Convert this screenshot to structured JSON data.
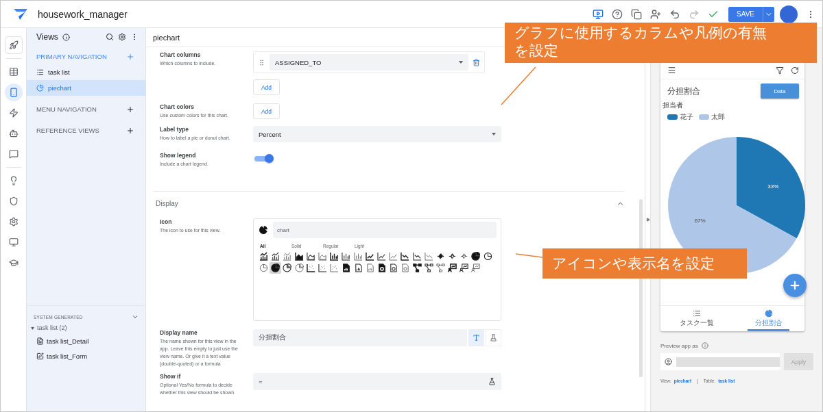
{
  "app": {
    "title": "housework_manager",
    "save_label": "SAVE"
  },
  "rail": {
    "groups": [
      {
        "items": [
          {
            "kind": "rocket",
            "selected": false
          }
        ]
      },
      {
        "items": [
          {
            "kind": "table",
            "selected": false
          },
          {
            "kind": "phone",
            "selected": true
          },
          {
            "kind": "bolt",
            "selected": false
          },
          {
            "kind": "robot",
            "selected": false
          },
          {
            "kind": "chat",
            "selected": false
          }
        ]
      },
      {
        "items": [
          {
            "kind": "bulb",
            "selected": false
          },
          {
            "kind": "shield",
            "selected": false
          },
          {
            "kind": "gear",
            "selected": false
          },
          {
            "kind": "monitor",
            "selected": false
          },
          {
            "kind": "cap",
            "selected": false
          }
        ]
      }
    ]
  },
  "sidebar": {
    "title": "Views",
    "sections": [
      {
        "label": "PRIMARY NAVIGATION",
        "items": [
          {
            "label": "task list",
            "kind": "list",
            "selected": false
          },
          {
            "label": "piechart",
            "kind": "pie",
            "selected": true
          }
        ]
      },
      {
        "label": "MENU NAVIGATION"
      },
      {
        "label": "REFERENCE VIEWS"
      }
    ],
    "system": {
      "label": "SYSTEM GENERATED",
      "expanded": true,
      "tree": [
        {
          "label": "task list (2)",
          "expanded": true,
          "children": [
            {
              "label": "task list_Detail",
              "kind": "detail"
            },
            {
              "label": "task list_Form",
              "kind": "form"
            }
          ]
        }
      ]
    }
  },
  "editor": {
    "title": "piechart",
    "fields": [
      {
        "kind": "columns",
        "label": "Chart columns",
        "hint": "Which columns to include.",
        "value": "ASSIGNED_TO",
        "add_label": "Add"
      },
      {
        "kind": "add",
        "label": "Chart colors",
        "hint": "Use custom colors for this chart.",
        "add_label": "Add"
      },
      {
        "kind": "select",
        "label": "Label type",
        "hint": "How to label a pie or donut chart.",
        "value": "Percent"
      },
      {
        "kind": "toggle",
        "label": "Show legend",
        "hint": "Include a chart legend.",
        "on": true
      }
    ],
    "section": {
      "title": "Display",
      "expanded": true,
      "fields": [
        {
          "kind": "icon",
          "label": "Icon",
          "hint": "The icon to use for this view.",
          "search": "chart",
          "filters": [
            {
              "label": "All",
              "selected": true
            },
            {
              "label": "Solid",
              "selected": false
            },
            {
              "label": "Regular",
              "selected": false
            },
            {
              "label": "Light",
              "selected": false
            }
          ],
          "icons": [
            {
              "kind": "barlinesolid",
              "selected": false
            },
            {
              "kind": "barlineregular",
              "selected": false
            },
            {
              "kind": "barlinelight",
              "selected": false
            },
            {
              "kind": "areasolid",
              "selected": false
            },
            {
              "kind": "arearegular",
              "selected": false
            },
            {
              "kind": "arealight",
              "selected": false
            },
            {
              "kind": "barsolid",
              "selected": false
            },
            {
              "kind": "barregular",
              "selected": false
            },
            {
              "kind": "barlight",
              "selected": false
            },
            {
              "kind": "linesolid",
              "selected": false
            },
            {
              "kind": "lineregular",
              "selected": false
            },
            {
              "kind": "linelight",
              "selected": false
            },
            {
              "kind": "linedownsolid",
              "selected": false
            },
            {
              "kind": "linedownregular",
              "selected": false
            },
            {
              "kind": "linedownlight",
              "selected": false
            },
            {
              "kind": "networksolid",
              "selected": false
            },
            {
              "kind": "networkregular",
              "selected": false
            },
            {
              "kind": "networklight",
              "selected": false
            },
            {
              "kind": "piesolid",
              "selected": false
            },
            {
              "kind": "pieoutlineregular",
              "selected": false
            },
            {
              "kind": "pieoutlinelight",
              "selected": false
            },
            {
              "kind": "piesolid",
              "selected": true
            },
            {
              "kind": "pieregular",
              "selected": false
            },
            {
              "kind": "pielight",
              "selected": false
            },
            {
              "kind": "scattersolid",
              "selected": false
            },
            {
              "kind": "scatterregular",
              "selected": false
            },
            {
              "kind": "scatterlight",
              "selected": false
            },
            {
              "kind": "filesolid",
              "selected": false
            },
            {
              "kind": "fileregular",
              "selected": false
            },
            {
              "kind": "filelight",
              "selected": false
            },
            {
              "kind": "filepiesolid",
              "selected": false
            },
            {
              "kind": "filepieregular",
              "selected": false
            },
            {
              "kind": "filepielight",
              "selected": false
            },
            {
              "kind": "flowsolid",
              "selected": false
            },
            {
              "kind": "flowregular",
              "selected": false
            },
            {
              "kind": "flowlight",
              "selected": false
            },
            {
              "kind": "presentationsolid",
              "selected": false
            },
            {
              "kind": "presentationregular",
              "selected": false
            },
            {
              "kind": "presentationlight",
              "selected": false
            }
          ]
        },
        {
          "kind": "text",
          "label": "Display name",
          "hint": "The name shown for this view in the app. Leave this empty to just use the view name. Or give it a text value (double-quoted) or a formula",
          "value": "分担割合",
          "modes": [
            {
              "kind": "text",
              "selected": true
            },
            {
              "kind": "formula",
              "selected": false
            }
          ]
        },
        {
          "kind": "formula",
          "label": "Show if",
          "hint": "Optional Yes/No formula to decide whether this view should be shown",
          "value": "="
        }
      ]
    }
  },
  "preview": {
    "phone": {
      "title": "分担割合",
      "data_button": "Data",
      "chart_data": {
        "type": "pie",
        "categories": [
          "花子",
          "太郎"
        ],
        "series": [
          {
            "name": "担当者",
            "values": [
              33,
              67
            ]
          }
        ],
        "value_labels": [
          "33%",
          "67%"
        ]
      },
      "legend": [
        {
          "color": "#1f77b4"
        },
        {
          "color": "#aec7e8"
        }
      ],
      "nav": [
        {
          "label": "タスク一覧",
          "kind": "list",
          "selected": false
        },
        {
          "label": "分担割合",
          "kind": "pie",
          "selected": true
        }
      ]
    },
    "preview_as": {
      "label": "Preview app as",
      "apply": "Apply",
      "apply_disabled": true
    },
    "footer": {
      "view_label": "View:",
      "view": "piechart",
      "separator": "|",
      "table_label": "Table:",
      "table": "task list"
    }
  },
  "callouts": [
    {
      "text": "グラフに使用するカラムや凡例の有無を設定"
    },
    {
      "text": "アイコンや表示名を設定"
    }
  ]
}
